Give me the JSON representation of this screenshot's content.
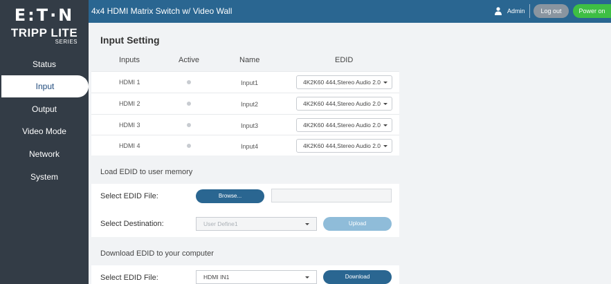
{
  "logo": {
    "brand": "E:T·N",
    "sub": "TRIPP LITE",
    "series": "SERIES"
  },
  "header": {
    "title": "4x4 HDMI Matrix Switch w/ Video Wall",
    "user": "Admin",
    "logout_label": "Log out",
    "power_label": "Power on"
  },
  "sidebar": {
    "items": [
      {
        "label": "Status"
      },
      {
        "label": "Input"
      },
      {
        "label": "Output"
      },
      {
        "label": "Video Mode"
      },
      {
        "label": "Network"
      },
      {
        "label": "System"
      }
    ],
    "active": "Input"
  },
  "input_setting": {
    "title": "Input Setting",
    "columns": {
      "inputs": "Inputs",
      "active": "Active",
      "name": "Name",
      "edid": "EDID"
    },
    "rows": [
      {
        "input": "HDMI 1",
        "name": "Input1",
        "edid": "4K2K60 444,Stereo Audio 2.0"
      },
      {
        "input": "HDMI 2",
        "name": "Input2",
        "edid": "4K2K60 444,Stereo Audio 2.0"
      },
      {
        "input": "HDMI 3",
        "name": "Input3",
        "edid": "4K2K60 444,Stereo Audio 2.0"
      },
      {
        "input": "HDMI 4",
        "name": "Input4",
        "edid": "4K2K60 444,Stereo Audio 2.0"
      }
    ]
  },
  "load_edid": {
    "title": "Load EDID to user memory",
    "file_label": "Select EDID File:",
    "browse_label": "Browse...",
    "dest_label": "Select Destination:",
    "dest_value": "User Define1",
    "upload_label": "Upload"
  },
  "download_edid": {
    "title": "Download EDID to your computer",
    "file_label": "Select EDID File:",
    "file_value": "HDMI IN1",
    "download_label": "Download"
  },
  "colors": {
    "sidebar": "#333c46",
    "header": "#2a6691",
    "power_on": "#3ebf44",
    "logout": "#8a95a0"
  }
}
